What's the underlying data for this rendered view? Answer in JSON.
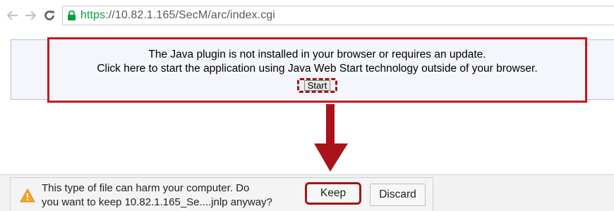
{
  "browser": {
    "url_scheme": "https",
    "url_scheme_sep": "://",
    "url_rest": "10.82.1.165/SecM/arc/index.cgi",
    "icons": {
      "back": "back-arrow-icon",
      "forward": "forward-arrow-icon",
      "reload": "reload-icon",
      "lock": "lock-icon"
    }
  },
  "notice": {
    "line1": "The Java plugin is not installed in your browser or requires an update.",
    "line2": "Click here to start the application using Java Web Start technology outside of your browser.",
    "start_label": "Start"
  },
  "download": {
    "warning_line1": "This type of file can harm your computer. Do",
    "warning_line2": "you want to keep 10.82.1.165_Se....jnlp anyway?",
    "keep_label": "Keep",
    "discard_label": "Discard",
    "icon": "warning-triangle-icon"
  },
  "colors": {
    "highlight": "#c8141e",
    "secure_green": "#0c9d3e",
    "warning_amber": "#f5a623"
  }
}
